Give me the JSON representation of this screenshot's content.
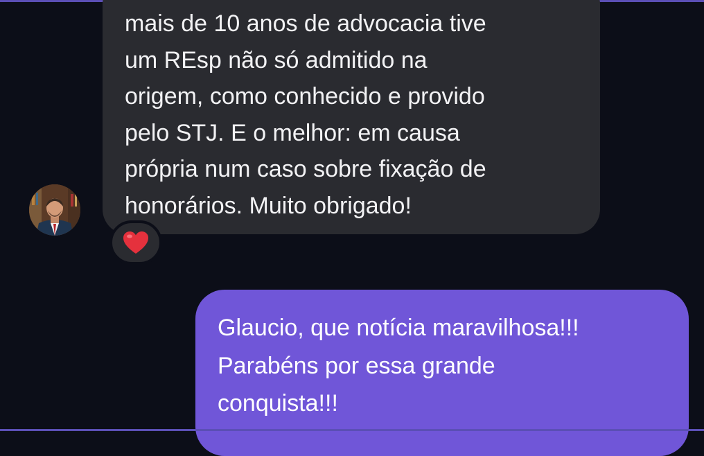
{
  "chat": {
    "incoming_message": {
      "lines": [
        "mais de 10 anos de advocacia tive",
        "um REsp não só admitido na",
        "origem, como conhecido e provido",
        "pelo STJ. E o melhor: em causa",
        "própria num caso sobre fixação de",
        "honorários. Muito obrigado!"
      ],
      "reaction": "❤️"
    },
    "outgoing_message": {
      "lines": [
        "Glaucio, que notícia maravilhosa!!!",
        "Parabéns por essa grande",
        "conquista!!!"
      ]
    }
  },
  "icons": {
    "reaction_icon": "heart-icon",
    "avatar": "user-avatar"
  },
  "colors": {
    "background": "#0c0e18",
    "incoming_bubble": "#2a2b30",
    "outgoing_bubble": "#7056d8",
    "accent_edge": "#5b4fb5",
    "reaction_heart": "#e5313d"
  }
}
